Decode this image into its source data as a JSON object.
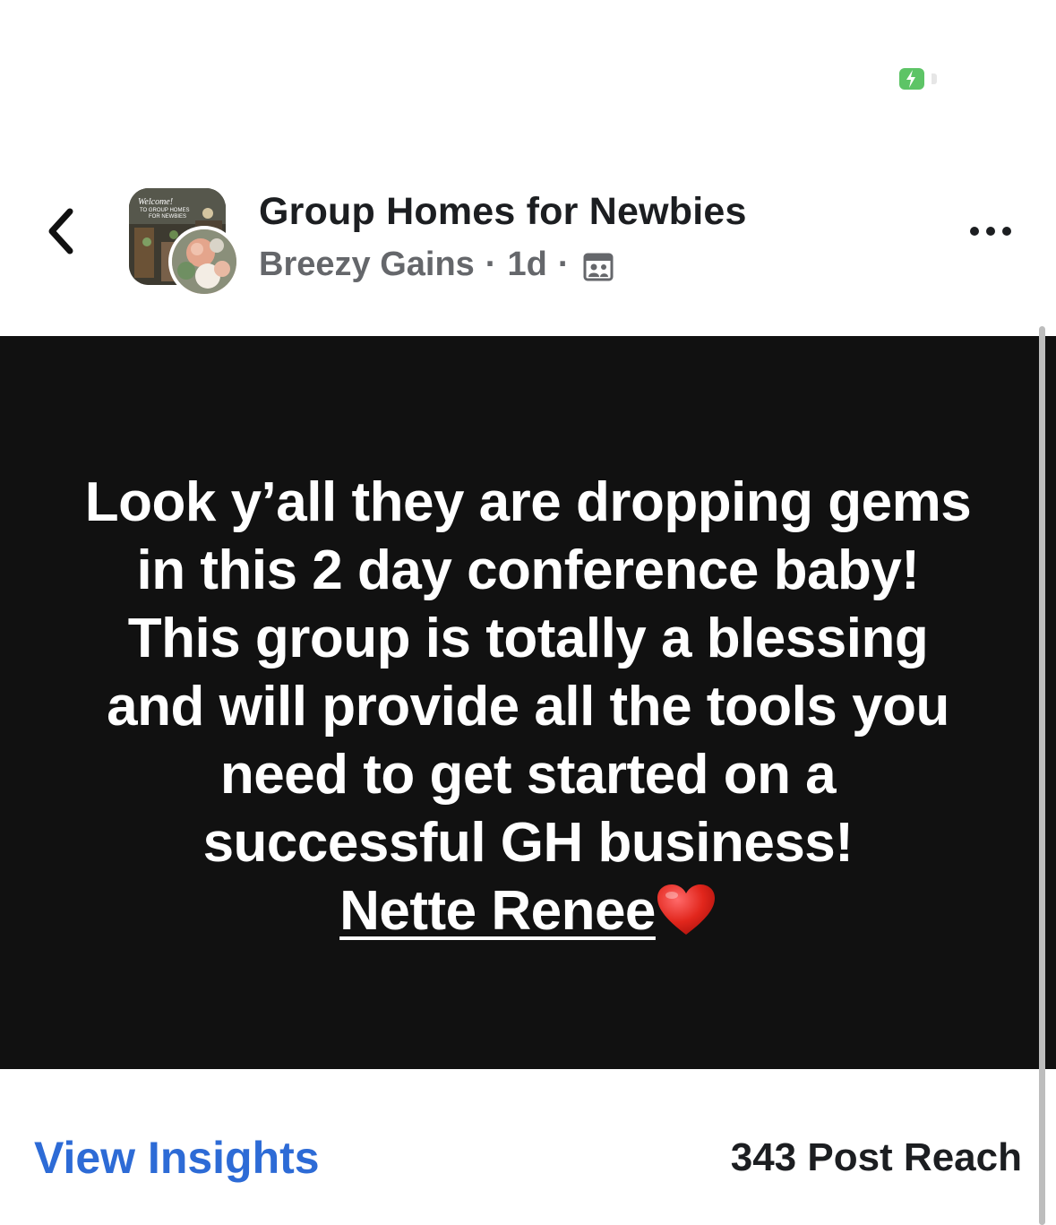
{
  "status_bar": {
    "battery_icon": "battery-charging-icon",
    "battery_color": "#5dc466"
  },
  "header": {
    "back_icon": "chevron-left-icon",
    "group_name": "Group Homes for Newbies",
    "author": "Breezy Gains",
    "separator": "·",
    "time": "1d",
    "privacy_icon": "group-members-icon",
    "more_icon": "more-horizontal-icon",
    "group_avatar_text": [
      "Welcome!",
      "TO GROUP HOMES",
      "FOR NEWBIES"
    ]
  },
  "post": {
    "background": "#111111",
    "body": "Look y’all they are dropping gems in this 2 day conference baby! This group is totally a blessing and will provide all the tools you need to get started on a successful GH business!",
    "mention": "Nette Renee",
    "emoji_icon": "red-heart-icon"
  },
  "footer": {
    "view_insights": "View Insights",
    "post_reach": "343 Post Reach",
    "link_color": "#2d6bd6"
  }
}
